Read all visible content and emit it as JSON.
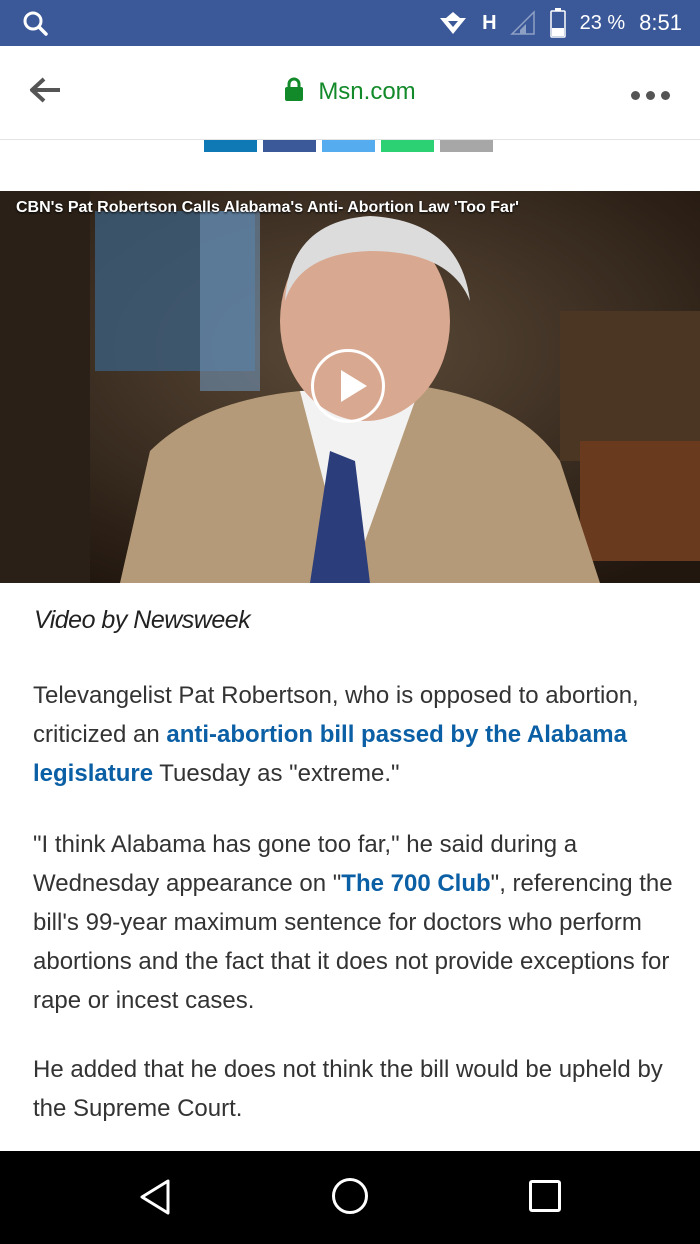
{
  "status_bar": {
    "network_type": "H",
    "battery_percent": "23 %",
    "time": "8:51"
  },
  "address_bar": {
    "url": "Msn.com"
  },
  "share_bar": {
    "colors": [
      "#0e79b5",
      "#3b5998",
      "#55acee",
      "#2bd172",
      "#a7a7a7"
    ]
  },
  "video": {
    "title": "CBN's Pat Robertson Calls Alabama's Anti- Abortion Law 'Too Far'"
  },
  "article": {
    "credit": "Video by Newsweek",
    "p1_before": "Televangelist Pat Robertson, who is opposed to abortion, criticized an ",
    "p1_link": "anti-abortion bill passed by the Alabama legislature",
    "p1_after": " Tuesday as \"extreme.\"",
    "p2_before": "\"I think Alabama has gone too far,\" he said during a Wednesday appearance on \"",
    "p2_link": "The 700 Club",
    "p2_after": "\", referencing the bill's 99-year maximum sentence for doctors who perform abortions and the fact that it does not provide exceptions for rape or incest cases.",
    "p3": "He added that he does not think the bill would be upheld by the Supreme Court."
  }
}
